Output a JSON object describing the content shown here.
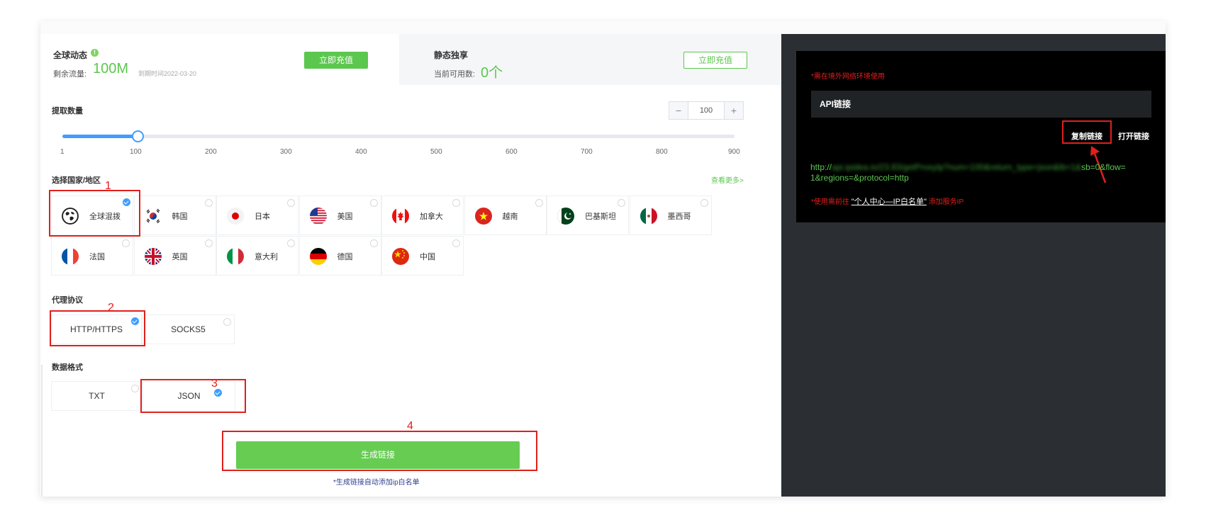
{
  "plans": {
    "global": {
      "title": "全球动态",
      "remaining_label": "剩余流量:",
      "remaining_value": "100M",
      "expiry": "到期时间2022-03-20",
      "button": "立即充值"
    },
    "static": {
      "title": "静态独享",
      "available_label": "当前可用数:",
      "available_value": "0个",
      "button": "立即充值"
    }
  },
  "quantity": {
    "label": "提取数量",
    "value": "100",
    "minus": "−",
    "plus": "+",
    "slider_value": 100,
    "slider_min": 1,
    "slider_max": 900,
    "ticks": [
      "1",
      "100",
      "200",
      "300",
      "400",
      "500",
      "600",
      "700",
      "800",
      "900"
    ]
  },
  "region": {
    "label": "选择国家/地区",
    "more": "查看更多>",
    "countries": [
      {
        "name": "全球混拨",
        "icon": "globe-icon",
        "selected": true
      },
      {
        "name": "韩国",
        "icon": "flag-kr-icon",
        "selected": false
      },
      {
        "name": "日本",
        "icon": "flag-jp-icon",
        "selected": false
      },
      {
        "name": "美国",
        "icon": "flag-us-icon",
        "selected": false
      },
      {
        "name": "加拿大",
        "icon": "flag-ca-icon",
        "selected": false
      },
      {
        "name": "越南",
        "icon": "flag-vn-icon",
        "selected": false
      },
      {
        "name": "巴基斯坦",
        "icon": "flag-pk-icon",
        "selected": false
      },
      {
        "name": "墨西哥",
        "icon": "flag-mx-icon",
        "selected": false
      },
      {
        "name": "法国",
        "icon": "flag-fr-icon",
        "selected": false
      },
      {
        "name": "英国",
        "icon": "flag-gb-icon",
        "selected": false
      },
      {
        "name": "意大利",
        "icon": "flag-it-icon",
        "selected": false
      },
      {
        "name": "德国",
        "icon": "flag-de-icon",
        "selected": false
      },
      {
        "name": "中国",
        "icon": "flag-cn-icon",
        "selected": false
      }
    ]
  },
  "protocol": {
    "label": "代理协议",
    "options": [
      {
        "name": "HTTP/HTTPS",
        "selected": true
      },
      {
        "name": "SOCKS5",
        "selected": false
      }
    ]
  },
  "format": {
    "label": "数据格式",
    "options": [
      {
        "name": "TXT",
        "selected": false
      },
      {
        "name": "JSON",
        "selected": true
      }
    ]
  },
  "generate": {
    "button": "生成链接",
    "note": "*生成链接自动添加ip白名单"
  },
  "annotations": [
    "1",
    "2",
    "3",
    "4"
  ],
  "api": {
    "warning": "*需在境外网络环境使用",
    "title": "API链接",
    "copy": "复制链接",
    "open": "打开链接",
    "url_prefix": "http://",
    "url_hidden": "api.ipidea.io/23.83/getProxyIp?num=100&return_type=json&lb=1&",
    "url_tail": "sb=0&flow=",
    "url_line2": "1&regions=&protocol=http",
    "whitelist_pre": "*使用需前往",
    "whitelist_link": "\"个人中心—IP白名单\"",
    "whitelist_post": "添加服务IP"
  },
  "colors": {
    "green": "#5cc74f",
    "blue": "#409eff",
    "red": "#e0201c",
    "dark": "#2b2f33"
  }
}
